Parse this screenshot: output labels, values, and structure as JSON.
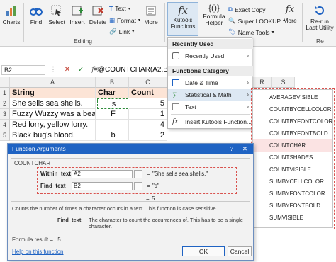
{
  "ribbon": {
    "charts": "Charts",
    "find": "Find",
    "select": "Select",
    "insert": "Insert",
    "delete": "Delete",
    "text": "Text",
    "format": "Format",
    "link": "Link",
    "more": "More",
    "editing": "Editing",
    "kutools_functions": "Kutools Functions",
    "formula_helper": "Formula Helper",
    "exact_copy": "Exact Copy",
    "super_lookup": "Super LOOKUP",
    "name_tools": "Name Tools",
    "more2": "More",
    "rerun": "Re-run Last Utility",
    "rerun_group": "Re"
  },
  "formula_bar": {
    "name_box": "B2",
    "fx": "fx",
    "formula": "=@COUNTCHAR(A2,B2)"
  },
  "grid": {
    "columns": [
      "A",
      "B",
      "C"
    ],
    "rows": [
      {
        "num": "1",
        "a": "String",
        "b": "Char",
        "c": "Count"
      },
      {
        "num": "2",
        "a": "She sells sea shells.",
        "b": "s",
        "c": "5"
      },
      {
        "num": "3",
        "a": "Fuzzy Wuzzy was a bear.",
        "b": "F",
        "c": "1"
      },
      {
        "num": "4",
        "a": "Red lorry, yellow lorry.",
        "b": "l",
        "c": "4"
      },
      {
        "num": "5",
        "a": "Black bug's blood.",
        "b": "b",
        "c": "2"
      }
    ],
    "extra_rows": [
      "6",
      "7",
      "8",
      "9",
      "10",
      "11",
      "12",
      "13",
      "14",
      "15",
      "16"
    ],
    "side_col": "S",
    "side_col_s": "R"
  },
  "kutools_menu": {
    "recently_used_header": "Recently Used",
    "recently_used": "Recently Used",
    "category_header": "Functions Category",
    "date_time": "Date & Time",
    "stat_math": "Statistical & Math",
    "text": "Text",
    "insert_function": "Insert Kutools Function..."
  },
  "submenu": {
    "items": [
      "AVERAGEVISIBLE",
      "COUNTBYCELLCOLOR",
      "COUNTBYFONTCOLOR",
      "COUNTBYFONTBOLD",
      "COUNTCHAR",
      "COUNTSHADES",
      "COUNTVISIBLE",
      "SUMBYCELLCOLOR",
      "SUMBYFONTCOLOR",
      "SUMBYFONTBOLD",
      "SUMVISIBLE"
    ],
    "selected_index": 4
  },
  "dialog": {
    "title": "Function Arguments",
    "help_glyph": "?",
    "close_glyph": "✕",
    "function_name": "COUNTCHAR",
    "within_text_label": "Within_text",
    "within_text_value": "A2",
    "within_text_result": "\"She sells sea shells.\"",
    "find_text_label": "Find_text",
    "find_text_value": "B2",
    "find_text_result": "\"s\"",
    "equals": "=",
    "overall_result": "5",
    "description": "Counts the number of times a character occurs in a text. This function is case sensitive.",
    "arg_help_label": "Find_text",
    "arg_help_text": "The character to count the occurrences of. This has to be a single character.",
    "formula_result_label": "Formula result =",
    "formula_result_value": "5",
    "help_link": "Help on this function",
    "ok": "OK",
    "cancel": "Cancel"
  }
}
